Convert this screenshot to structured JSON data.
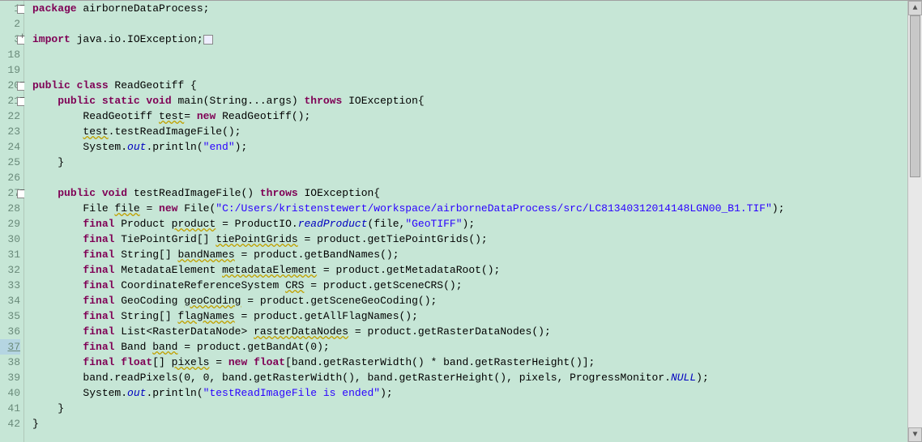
{
  "lines": [
    {
      "num": "1",
      "fold": "minus",
      "tokens": [
        [
          "kw",
          "package"
        ],
        [
          "",
          " airborneDataProcess;"
        ]
      ]
    },
    {
      "num": "2",
      "fold": "",
      "tokens": []
    },
    {
      "num": "3",
      "fold": "plus",
      "suffix": "+",
      "tokens": [
        [
          "kw",
          "import"
        ],
        [
          "",
          " java.io.IOException;"
        ],
        [
          "box",
          ""
        ]
      ]
    },
    {
      "num": "18",
      "fold": "",
      "tokens": []
    },
    {
      "num": "19",
      "fold": "",
      "tokens": []
    },
    {
      "num": "20",
      "fold": "minus",
      "tokens": [
        [
          "kw",
          "public class"
        ],
        [
          "",
          " ReadGeotiff {"
        ]
      ]
    },
    {
      "num": "21",
      "fold": "minus",
      "tokens": [
        [
          "",
          "    "
        ],
        [
          "kw",
          "public static void"
        ],
        [
          "",
          " main(String...args) "
        ],
        [
          "kw",
          "throws"
        ],
        [
          "",
          " IOException{"
        ]
      ]
    },
    {
      "num": "22",
      "fold": "",
      "tokens": [
        [
          "",
          "        ReadGeotiff "
        ],
        [
          "warn",
          "test"
        ],
        [
          "",
          "= "
        ],
        [
          "kw",
          "new"
        ],
        [
          "",
          " ReadGeotiff();"
        ]
      ]
    },
    {
      "num": "23",
      "fold": "",
      "tokens": [
        [
          "",
          "        "
        ],
        [
          "warn",
          "test"
        ],
        [
          "",
          ".testReadImageFile();"
        ]
      ]
    },
    {
      "num": "24",
      "fold": "",
      "tokens": [
        [
          "",
          "        System."
        ],
        [
          "field",
          "out"
        ],
        [
          "",
          ".println("
        ],
        [
          "str",
          "\"end\""
        ],
        [
          "",
          ");"
        ]
      ]
    },
    {
      "num": "25",
      "fold": "",
      "tokens": [
        [
          "",
          "    }"
        ]
      ]
    },
    {
      "num": "26",
      "fold": "",
      "tokens": []
    },
    {
      "num": "27",
      "fold": "minus",
      "tokens": [
        [
          "",
          "    "
        ],
        [
          "kw",
          "public void"
        ],
        [
          "",
          " testReadImageFile() "
        ],
        [
          "kw",
          "throws"
        ],
        [
          "",
          " IOException{"
        ]
      ]
    },
    {
      "num": "28",
      "fold": "",
      "tokens": [
        [
          "",
          "        File "
        ],
        [
          "warn",
          "file"
        ],
        [
          "",
          " = "
        ],
        [
          "kw",
          "new"
        ],
        [
          "",
          " File("
        ],
        [
          "str",
          "\"C:/Users/kristenstewert/workspace/airborneDataProcess/src/LC81340312014148LGN00_B1.TIF\""
        ],
        [
          "",
          ");"
        ]
      ]
    },
    {
      "num": "29",
      "fold": "",
      "tokens": [
        [
          "",
          "        "
        ],
        [
          "kw",
          "final"
        ],
        [
          "",
          " Product "
        ],
        [
          "warn",
          "product"
        ],
        [
          "",
          " = ProductIO."
        ],
        [
          "field",
          "readProduct"
        ],
        [
          "",
          "(file,"
        ],
        [
          "str",
          "\"GeoTIFF\""
        ],
        [
          "",
          ");"
        ]
      ]
    },
    {
      "num": "30",
      "fold": "",
      "tokens": [
        [
          "",
          "        "
        ],
        [
          "kw",
          "final"
        ],
        [
          "",
          " TiePointGrid[] "
        ],
        [
          "warn",
          "tiePointGrids"
        ],
        [
          "",
          " = product.getTiePointGrids();"
        ]
      ]
    },
    {
      "num": "31",
      "fold": "",
      "tokens": [
        [
          "",
          "        "
        ],
        [
          "kw",
          "final"
        ],
        [
          "",
          " String[] "
        ],
        [
          "warn",
          "bandNames"
        ],
        [
          "",
          " = product.getBandNames();"
        ]
      ]
    },
    {
      "num": "32",
      "fold": "",
      "tokens": [
        [
          "",
          "        "
        ],
        [
          "kw",
          "final"
        ],
        [
          "",
          " MetadataElement "
        ],
        [
          "warn",
          "metadataElement"
        ],
        [
          "",
          " = product.getMetadataRoot();"
        ]
      ]
    },
    {
      "num": "33",
      "fold": "",
      "tokens": [
        [
          "",
          "        "
        ],
        [
          "kw",
          "final"
        ],
        [
          "",
          " CoordinateReferenceSystem "
        ],
        [
          "warn",
          "CRS"
        ],
        [
          "",
          " = product.getSceneCRS();"
        ]
      ]
    },
    {
      "num": "34",
      "fold": "",
      "tokens": [
        [
          "",
          "        "
        ],
        [
          "kw",
          "final"
        ],
        [
          "",
          " GeoCoding "
        ],
        [
          "warn",
          "geoCoding"
        ],
        [
          "",
          " = product.getSceneGeoCoding();"
        ]
      ]
    },
    {
      "num": "35",
      "fold": "",
      "tokens": [
        [
          "",
          "        "
        ],
        [
          "kw",
          "final"
        ],
        [
          "",
          " String[] "
        ],
        [
          "warn",
          "flagNames"
        ],
        [
          "",
          " = product.getAllFlagNames();"
        ]
      ]
    },
    {
      "num": "36",
      "fold": "",
      "tokens": [
        [
          "",
          "        "
        ],
        [
          "kw",
          "final"
        ],
        [
          "",
          " List<RasterDataNode> "
        ],
        [
          "warn",
          "rasterDataNodes"
        ],
        [
          "",
          " = product.getRasterDataNodes();"
        ]
      ]
    },
    {
      "num": "37",
      "fold": "",
      "hl": true,
      "tokens": [
        [
          "",
          "        "
        ],
        [
          "kw",
          "final"
        ],
        [
          "",
          " Band "
        ],
        [
          "warn",
          "band"
        ],
        [
          "",
          " = product.getBandAt(0);"
        ]
      ]
    },
    {
      "num": "38",
      "fold": "",
      "tokens": [
        [
          "",
          "        "
        ],
        [
          "kw",
          "final float"
        ],
        [
          "",
          "[] "
        ],
        [
          "warn",
          "pixels"
        ],
        [
          "",
          " = "
        ],
        [
          "kw",
          "new float"
        ],
        [
          "",
          "[band.getRasterWidth() * band.getRasterHeight()];"
        ]
      ]
    },
    {
      "num": "39",
      "fold": "",
      "tokens": [
        [
          "",
          "        band.readPixels(0, 0, band.getRasterWidth(), band.getRasterHeight(), pixels, ProgressMonitor."
        ],
        [
          "field",
          "NULL"
        ],
        [
          "",
          ");"
        ]
      ]
    },
    {
      "num": "40",
      "fold": "",
      "tokens": [
        [
          "",
          "        System."
        ],
        [
          "field",
          "out"
        ],
        [
          "",
          ".println("
        ],
        [
          "str",
          "\"testReadImageFile is ended\""
        ],
        [
          "",
          ");"
        ]
      ]
    },
    {
      "num": "41",
      "fold": "",
      "tokens": [
        [
          "",
          "    }"
        ]
      ]
    },
    {
      "num": "42",
      "fold": "",
      "tokens": [
        [
          "",
          "}"
        ]
      ]
    }
  ]
}
